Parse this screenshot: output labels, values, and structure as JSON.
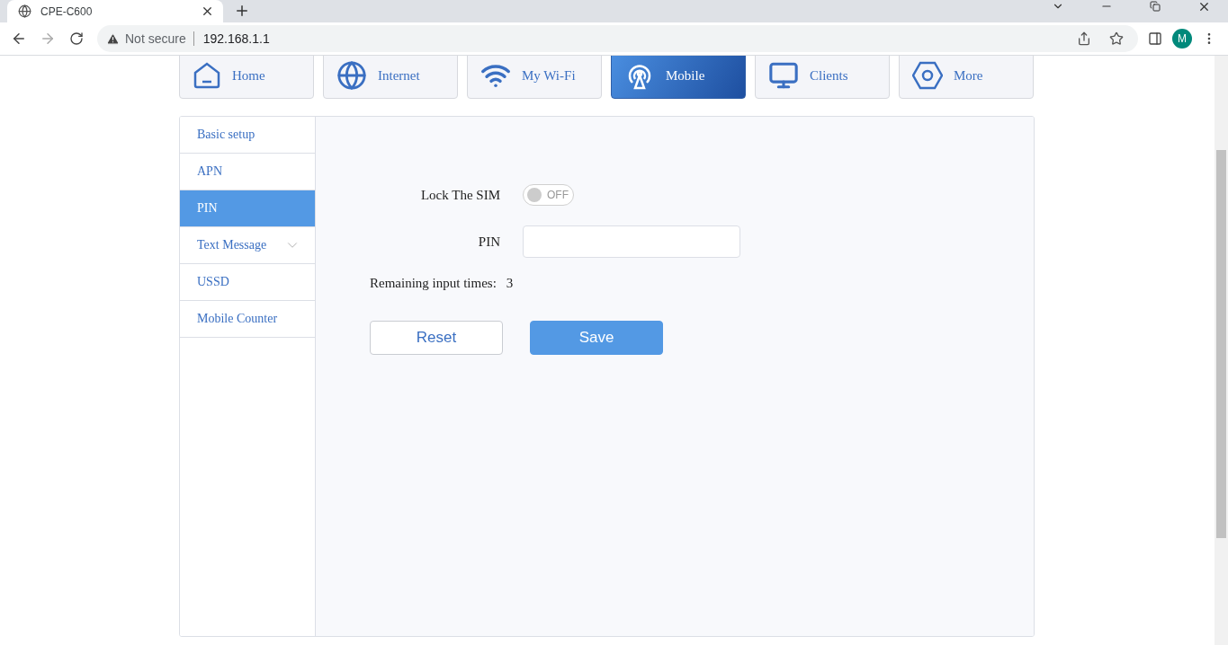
{
  "browser": {
    "tab_title": "CPE-C600",
    "security": "Not secure",
    "url": "192.168.1.1",
    "profile": "M"
  },
  "nav": [
    {
      "label": "Home",
      "selected": false
    },
    {
      "label": "Internet",
      "selected": false
    },
    {
      "label": "My Wi-Fi",
      "selected": false
    },
    {
      "label": "Mobile",
      "selected": true
    },
    {
      "label": "Clients",
      "selected": false
    },
    {
      "label": "More",
      "selected": false
    }
  ],
  "sidebar": {
    "items": [
      {
        "label": "Basic setup",
        "selected": false,
        "kind": "link"
      },
      {
        "label": "APN",
        "selected": false,
        "kind": "link"
      },
      {
        "label": "PIN",
        "selected": true,
        "kind": "link"
      },
      {
        "label": "Text Message",
        "selected": false,
        "kind": "group"
      },
      {
        "label": "USSD",
        "selected": false,
        "kind": "link"
      },
      {
        "label": "Mobile Counter",
        "selected": false,
        "kind": "link"
      }
    ]
  },
  "form": {
    "lock_sim": {
      "label": "Lock The SIM",
      "on": false,
      "state_text": "OFF"
    },
    "pin": {
      "label": "PIN"
    },
    "remaining": {
      "label": "Remaining input times:",
      "value": "3"
    },
    "buttons": [
      {
        "label": "Reset",
        "kind": "secondary"
      },
      {
        "label": "Save",
        "kind": "primary"
      }
    ]
  }
}
